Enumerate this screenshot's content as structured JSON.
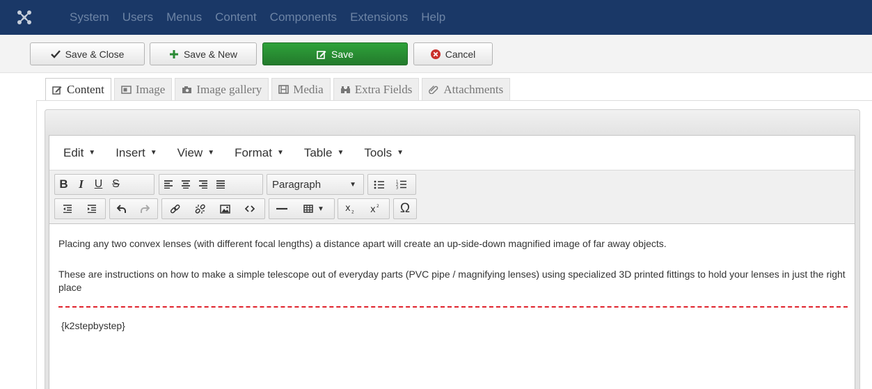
{
  "nav": {
    "items": [
      "System",
      "Users",
      "Menus",
      "Content",
      "Components",
      "Extensions",
      "Help"
    ]
  },
  "toolbar": {
    "save_close_label": "Save & Close",
    "save_new_label": "Save & New",
    "save_label": "Save",
    "cancel_label": "Cancel"
  },
  "tabs": [
    {
      "label": "Content",
      "icon": "edit-icon"
    },
    {
      "label": "Image",
      "icon": "image-icon"
    },
    {
      "label": "Image gallery",
      "icon": "camera-icon"
    },
    {
      "label": "Media",
      "icon": "film-icon"
    },
    {
      "label": "Extra Fields",
      "icon": "binoculars-icon"
    },
    {
      "label": "Attachments",
      "icon": "paperclip-icon"
    }
  ],
  "editor": {
    "menus": [
      "Edit",
      "Insert",
      "View",
      "Format",
      "Table",
      "Tools"
    ],
    "format_select": "Paragraph",
    "content": {
      "para1": "Placing any two convex lenses (with different focal lengths) a distance apart will create an up-side-down magnified image of far away objects.",
      "para2": "These are instructions on how to make a simple telescope out of everyday parts (PVC pipe / magnifying lenses) using specialized 3D printed fittings to hold your lenses in just the right place",
      "tag": "{k2stepbystep}"
    }
  },
  "colors": {
    "nav_bg": "#1a3867",
    "nav_text": "#6d84a5",
    "save_green": "#2a9136",
    "cancel_red": "#c9302c",
    "pagebreak_red": "#e0222c"
  }
}
